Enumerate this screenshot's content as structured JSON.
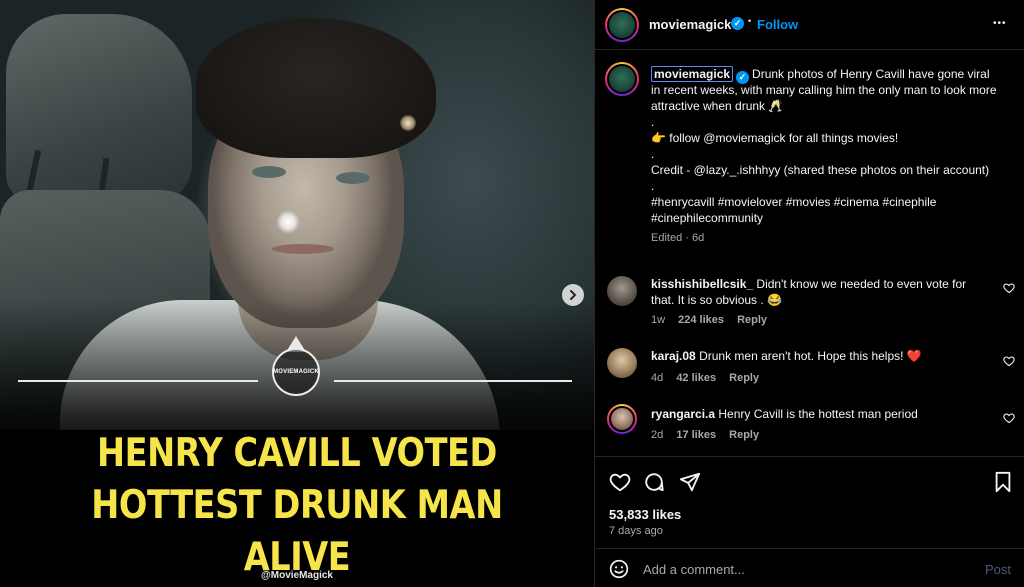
{
  "post": {
    "headline_line1": "HENRY CAVILL VOTED",
    "headline_line2": "HOTTEST DRUNK MAN ALIVE",
    "logo_text": "MOVIEMAGICK",
    "watermark": "@MovieMagick",
    "carousel_next": "›"
  },
  "header": {
    "username": "moviemagick",
    "separator": "•",
    "follow_label": "Follow",
    "more_label": "•••"
  },
  "caption": {
    "username": "moviemagick",
    "line1": "Drunk photos of Henry Cavill have gone viral in recent weeks, with many calling him the only man to look more attractive when drunk 🥂",
    "dot1": ".",
    "line2": "👉 follow @moviemagick for all things movies!",
    "dot2": ".",
    "line3": "Credit - @lazy._.ishhhyy (shared these photos on their account)",
    "dot3": ".",
    "hashtags": "#henrycavill #movielover #movies #cinema #cinephile #cinephilecommunity",
    "edited": "Edited · 6d"
  },
  "comments": [
    {
      "username": "kisshishibellcsik_",
      "text": "Didn't know we needed to even vote for that. It is so obvious . 😂",
      "age": "1w",
      "likes": "224 likes",
      "reply": "Reply"
    },
    {
      "username": "karaj.08",
      "text": "Drunk men aren't hot. Hope this helps! ❤️",
      "age": "4d",
      "likes": "42 likes",
      "reply": "Reply"
    },
    {
      "username": "ryangarci.a",
      "text": "Henry Cavill is the hottest man period",
      "age": "2d",
      "likes": "17 likes",
      "reply": "Reply"
    }
  ],
  "stats": {
    "likes": "53,833 likes",
    "ago": "7 days ago"
  },
  "composer": {
    "placeholder": "Add a comment...",
    "post_label": "Post"
  },
  "colors": {
    "accent": "#0095f6",
    "headline": "#f6e54a",
    "background": "#000000"
  }
}
